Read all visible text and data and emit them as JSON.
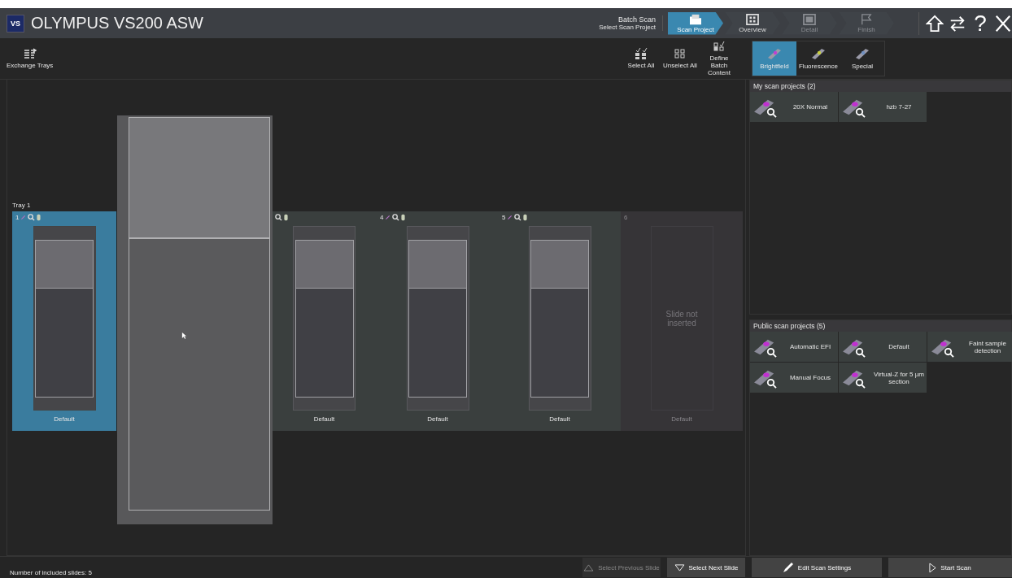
{
  "window": {
    "logo": "VS",
    "title": "OLYMPUS VS200 ASW"
  },
  "mode": {
    "title": "Batch Scan",
    "subtitle": "Select Scan Project"
  },
  "steps": [
    {
      "label": "Scan Project",
      "selected": true,
      "disabled": false
    },
    {
      "label": "Overview",
      "selected": false,
      "disabled": false
    },
    {
      "label": "Detail",
      "selected": false,
      "disabled": true
    },
    {
      "label": "Finish",
      "selected": false,
      "disabled": true
    }
  ],
  "window_buttons": [
    {
      "kind": "home"
    },
    {
      "kind": "swap"
    },
    {
      "kind": "help",
      "label": "?"
    },
    {
      "kind": "close"
    }
  ],
  "toolbar": {
    "exchange": "Exchange Trays",
    "selection": [
      {
        "kind": "select",
        "label": "Select All"
      },
      {
        "kind": "unselect",
        "label": "Unselect All"
      },
      {
        "kind": "define",
        "label": "Define Batch Content"
      }
    ]
  },
  "sample_types": [
    {
      "label": "Brightfield",
      "selected": true,
      "color": "#c040d0"
    },
    {
      "label": "Fluorescence",
      "selected": false,
      "color": "#c8d040"
    },
    {
      "label": "Special",
      "selected": false,
      "color": "#7090c0"
    }
  ],
  "tray": {
    "label": "Tray 1",
    "slots": [
      {
        "kind": "slide",
        "number": "1",
        "edit_icon": true,
        "selected": true,
        "label": "Default"
      },
      {
        "kind": "covered"
      },
      {
        "kind": "slide",
        "edit_icon": false,
        "selected": false,
        "label": "Default"
      },
      {
        "kind": "slide",
        "number": "4",
        "edit_icon": true,
        "selected": false,
        "label": "Default"
      },
      {
        "kind": "slide",
        "number": "5",
        "edit_icon": true,
        "selected": false,
        "label": "Default"
      },
      {
        "kind": "empty",
        "number": "6",
        "message": "Slide not inserted",
        "label": "Default"
      }
    ]
  },
  "my_projects": {
    "title": "My scan projects (2)",
    "items": [
      "20X Normal",
      "hzb 7-27"
    ]
  },
  "public_projects": {
    "title": "Public scan projects (5)",
    "items": [
      "Automatic EFI",
      "Default",
      "Faint sample detection",
      "Manual Focus",
      "Virtual-Z for 5 µm section"
    ]
  },
  "status": "Number of included slides: 5",
  "buttons": [
    {
      "kind": "previous",
      "label": "Select Previous Slide",
      "disabled": true
    },
    {
      "kind": "next",
      "label": "Select Next Slide",
      "disabled": false
    },
    {
      "kind": "edit",
      "label": "Edit Scan Settings",
      "disabled": false
    },
    {
      "kind": "start",
      "label": "Start Scan",
      "disabled": false
    }
  ]
}
